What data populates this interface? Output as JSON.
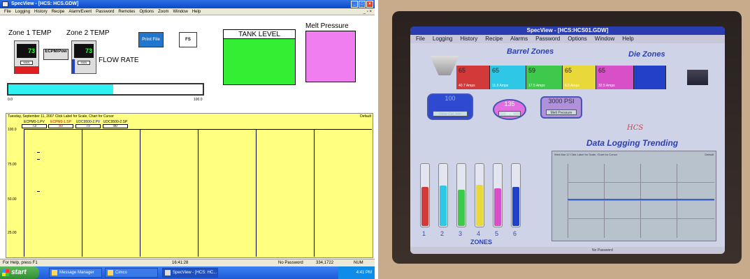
{
  "left": {
    "title": "SpecView - [HCS: HCS.GDW]",
    "menu": [
      "File",
      "Logging",
      "History",
      "Recipe",
      "Alarm/Event",
      "Password",
      "Remotes",
      "Options",
      "Zoom",
      "Window",
      "Help"
    ],
    "hmi": {
      "zone1_label": "Zone 1 TEMP",
      "zone2_label": "Zone 2 TEMP",
      "zone1_value": "73",
      "zone2_value": "73",
      "mode_label": "MAN",
      "ecpm_button": "ECPM/Pow",
      "flow_rate_label": "FLOW RATE",
      "print_button": "Print File",
      "fs_button": "FS",
      "tank_level_label": "TANK LEVEL",
      "melt_pressure_label": "Melt Pressure",
      "flow_progress": 0.54,
      "tick_min": "0.0",
      "tick_max": "100.0",
      "colors": {
        "tank": "#33ee33",
        "melt": "#f07ef0",
        "flow": "#2ef2f2"
      }
    },
    "trend": {
      "header": "Tuesday, September 11, 2007   Click Label for Scale, Chart for Cursor",
      "default_label": "Default",
      "pens": [
        {
          "name": "ECPM0-1.PV",
          "value": "73"
        },
        {
          "name": "ECPM0-1.SP",
          "value": "80"
        },
        {
          "name": "UDC9500-2.PV",
          "value": "79"
        },
        {
          "name": "UDC9500-2.SP",
          "value": "80"
        }
      ],
      "y_labels": [
        "100.0",
        "75.00",
        "50.00",
        "25.00"
      ]
    },
    "status": {
      "help": "For Help, press F1",
      "time": "16:41:28",
      "password": "No Password",
      "memory": "334,1722",
      "num": "NUM"
    },
    "taskbar": {
      "start": "start",
      "tasks": [
        "Message Manager",
        "Cimco",
        "SpecView - [HCS: HC..."
      ],
      "clock": "4:41 PM"
    }
  },
  "right": {
    "title": "SpecView - [HCS:HCS01.GDW]",
    "menu": [
      "File",
      "Logging",
      "History",
      "Recipe",
      "Alarms",
      "Password",
      "Options",
      "Window",
      "Help"
    ],
    "barrel_zones_label": "Barrel Zones",
    "die_zones_label": "Die  Zones",
    "zones": [
      {
        "temp": "65",
        "amps": "40.7 Amps",
        "color": "#d23a3a"
      },
      {
        "temp": "65",
        "amps": "11.5 Amps",
        "color": "#2ec8e6"
      },
      {
        "temp": "59",
        "amps": "17.5 Amps",
        "color": "#3ec84c"
      },
      {
        "temp": "65",
        "amps": "6.5 Amps",
        "color": "#e8d83a"
      },
      {
        "temp": "65",
        "amps": "32.5 Amps",
        "color": "#d850c8"
      },
      {
        "temp": "",
        "amps": "",
        "color": "#2240c8"
      }
    ],
    "pill_drive": {
      "value": "100",
      "sub": "Drive Cal_Inm"
    },
    "pill_rpm": {
      "value": "135",
      "sub": "RPM"
    },
    "pill_melt": {
      "value": "3000 PSI",
      "sub": "Melt Pressure"
    },
    "hcs_label": "HCS",
    "trending_label": "Data Logging Trending",
    "tubes": [
      {
        "num": "1",
        "level": 0.62,
        "color": "#d23a3a"
      },
      {
        "num": "2",
        "level": 0.64,
        "color": "#2ec8e6"
      },
      {
        "num": "3",
        "level": 0.58,
        "color": "#3ec84c"
      },
      {
        "num": "4",
        "level": 0.66,
        "color": "#e8d83a"
      },
      {
        "num": "5",
        "level": 0.6,
        "color": "#d850c8"
      },
      {
        "num": "6",
        "level": 0.62,
        "color": "#2240c8"
      }
    ],
    "zones_label": "ZONES",
    "chart_header": "Wed Mar 12   Click Label for Scale, Chart for Cursor",
    "chart_default": "Default",
    "status_password": "No Password"
  }
}
